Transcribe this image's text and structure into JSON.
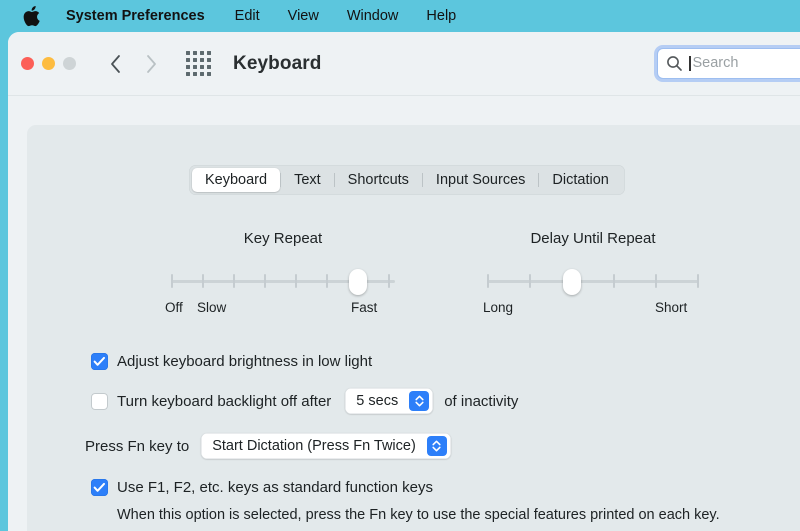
{
  "menubar": {
    "apple_icon": "apple-logo-icon",
    "items": [
      {
        "label": "System Preferences",
        "bold": true
      },
      {
        "label": "Edit",
        "bold": false
      },
      {
        "label": "View",
        "bold": false
      },
      {
        "label": "Window",
        "bold": false
      },
      {
        "label": "Help",
        "bold": false
      }
    ],
    "background": "#5cc6dd"
  },
  "titlebar": {
    "traffic_lights": [
      {
        "name": "close",
        "color": "#fc5f57"
      },
      {
        "name": "minimize",
        "color": "#fdbc40"
      },
      {
        "name": "zoom",
        "color": "#ced4d6"
      }
    ],
    "back_icon": "chevron-left-icon",
    "forward_icon": "chevron-right-icon",
    "grid_icon": "show-all-grid-icon",
    "title": "Keyboard"
  },
  "search": {
    "icon": "search-icon",
    "placeholder": "Search",
    "value": "",
    "focused": true,
    "focus_ring_color": "#6ea0f5"
  },
  "tabs": [
    {
      "label": "Keyboard",
      "active": true
    },
    {
      "label": "Text",
      "active": false
    },
    {
      "label": "Shortcuts",
      "active": false
    },
    {
      "label": "Input Sources",
      "active": false
    },
    {
      "label": "Dictation",
      "active": false
    }
  ],
  "sliders": [
    {
      "name": "key-repeat",
      "title": "Key Repeat",
      "ticks": 8,
      "value_index": 7,
      "labels": {
        "left": "Off",
        "second": "Slow",
        "right": "Fast"
      }
    },
    {
      "name": "delay-until-repeat",
      "title": "Delay Until Repeat",
      "ticks": 6,
      "value_index": 3,
      "labels": {
        "left": "Long",
        "right": "Short"
      }
    }
  ],
  "options": {
    "adjust_brightness": {
      "label": "Adjust keyboard brightness in low light",
      "checked": true
    },
    "backlight_off": {
      "label_before": "Turn keyboard backlight off after",
      "label_after": "of inactivity",
      "checked": false,
      "popup_value": "5 secs"
    },
    "fn_key": {
      "label": "Press Fn key to",
      "popup_value": "Start Dictation (Press Fn Twice)"
    },
    "function_keys": {
      "label": "Use F1, F2, etc. keys as standard function keys",
      "checked": true,
      "help": "When this option is selected, press the Fn key to use the special features printed on each key."
    }
  },
  "colors": {
    "accent": "#2d7ff9",
    "window_bg": "#eef2f4",
    "panel_bg": "#e3e9eb",
    "desktop": "#5cc6dd"
  }
}
